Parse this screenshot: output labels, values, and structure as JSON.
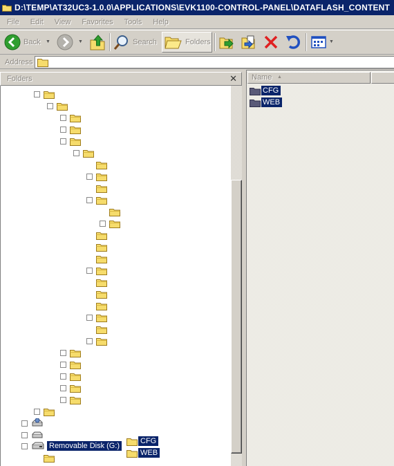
{
  "window": {
    "title": "D:\\TEMP\\AT32UC3-1.0.0\\APPLICATIONS\\EVK1100-CONTROL-PANEL\\DATAFLASH_CONTENT"
  },
  "menu": [
    "File",
    "Edit",
    "View",
    "Favorites",
    "Tools",
    "Help"
  ],
  "toolbar": {
    "back_label": "Back",
    "search_label": "Search",
    "folders_label": "Folders"
  },
  "address": {
    "label": "Address"
  },
  "folders_pane": {
    "title": "Folders",
    "close_glyph": "✕"
  },
  "details": {
    "column_name": "Name",
    "sort_glyph": "▲",
    "items": [
      {
        "name": "CFG"
      },
      {
        "name": "WEB"
      }
    ]
  },
  "tree": {
    "drive_label": "Removable Disk (G:)",
    "drive_children": [
      {
        "name": "CFG"
      },
      {
        "name": "WEB"
      }
    ]
  },
  "colors": {
    "titlebar": "#0a246a",
    "selection": "#0a246a",
    "folder_yellow": "#f6dc6c",
    "folder_dark": "#5a5a78"
  }
}
